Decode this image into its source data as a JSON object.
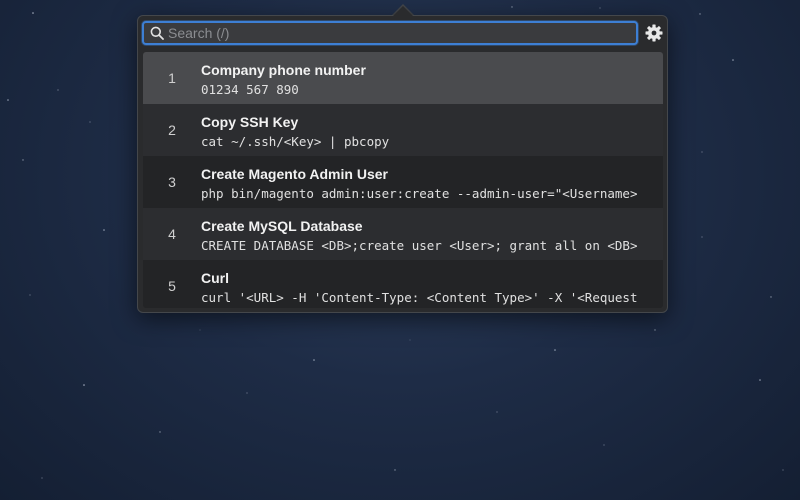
{
  "search": {
    "value": "",
    "placeholder": "Search (/)",
    "icon": "search-icon"
  },
  "settings": {
    "icon": "gear-icon"
  },
  "colors": {
    "focus_ring": "#3d7fd4",
    "selected_row": "#4a4b4e",
    "panel": "#2a2b2d"
  },
  "snippets": [
    {
      "index": "1",
      "title": "Company phone number",
      "content": "01234 567 890",
      "selected": true
    },
    {
      "index": "2",
      "title": "Copy SSH Key",
      "content": "cat ~/.ssh/<Key> | pbcopy",
      "selected": false
    },
    {
      "index": "3",
      "title": "Create Magento Admin User",
      "content": "php bin/magento admin:user:create --admin-user=\"<Username>",
      "selected": false
    },
    {
      "index": "4",
      "title": "Create MySQL Database",
      "content": "CREATE DATABASE <DB>;create user <User>; grant all on <DB>",
      "selected": false
    },
    {
      "index": "5",
      "title": "Curl",
      "content": "curl '<URL> -H 'Content-Type: <Content Type>' -X '<Request",
      "selected": false
    }
  ]
}
